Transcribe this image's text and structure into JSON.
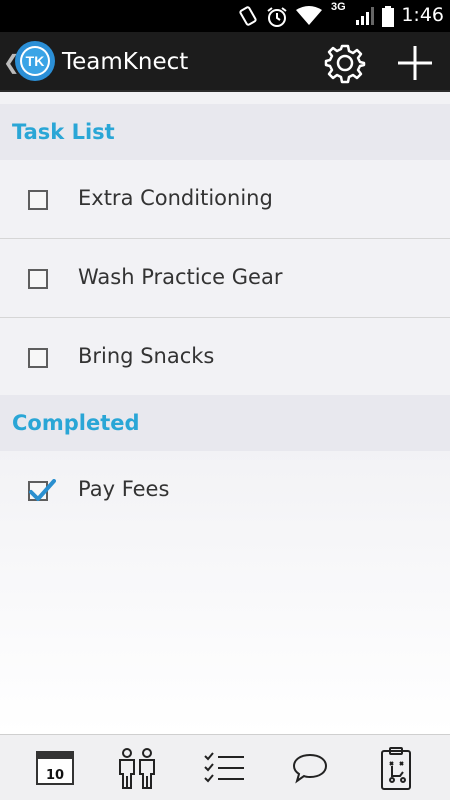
{
  "status_bar": {
    "time": "1:46",
    "network": "3G",
    "icons": [
      "rotate-icon",
      "alarm-icon",
      "wifi-icon",
      "signal-icon",
      "battery-icon"
    ]
  },
  "app_bar": {
    "title": "TeamKnect",
    "logo_text": "TK",
    "icons": [
      "back-caret-icon",
      "settings-gear-icon",
      "add-plus-icon"
    ]
  },
  "sections": {
    "task_list": {
      "header": "Task List",
      "items": [
        {
          "label": "Extra Conditioning",
          "checked": false
        },
        {
          "label": "Wash Practice Gear",
          "checked": false
        },
        {
          "label": "Bring Snacks",
          "checked": false
        }
      ]
    },
    "completed": {
      "header": "Completed",
      "items": [
        {
          "label": "Pay Fees",
          "checked": true
        }
      ]
    }
  },
  "bottom_nav": {
    "calendar_day": "10",
    "icons": [
      "calendar-icon",
      "team-roster-icon",
      "task-list-icon",
      "chat-bubble-icon",
      "clipboard-play-icon"
    ]
  },
  "colors": {
    "accent": "#2aa6d6",
    "action_bar": "#1c1c1c",
    "check_blue": "#2a8fcf"
  }
}
